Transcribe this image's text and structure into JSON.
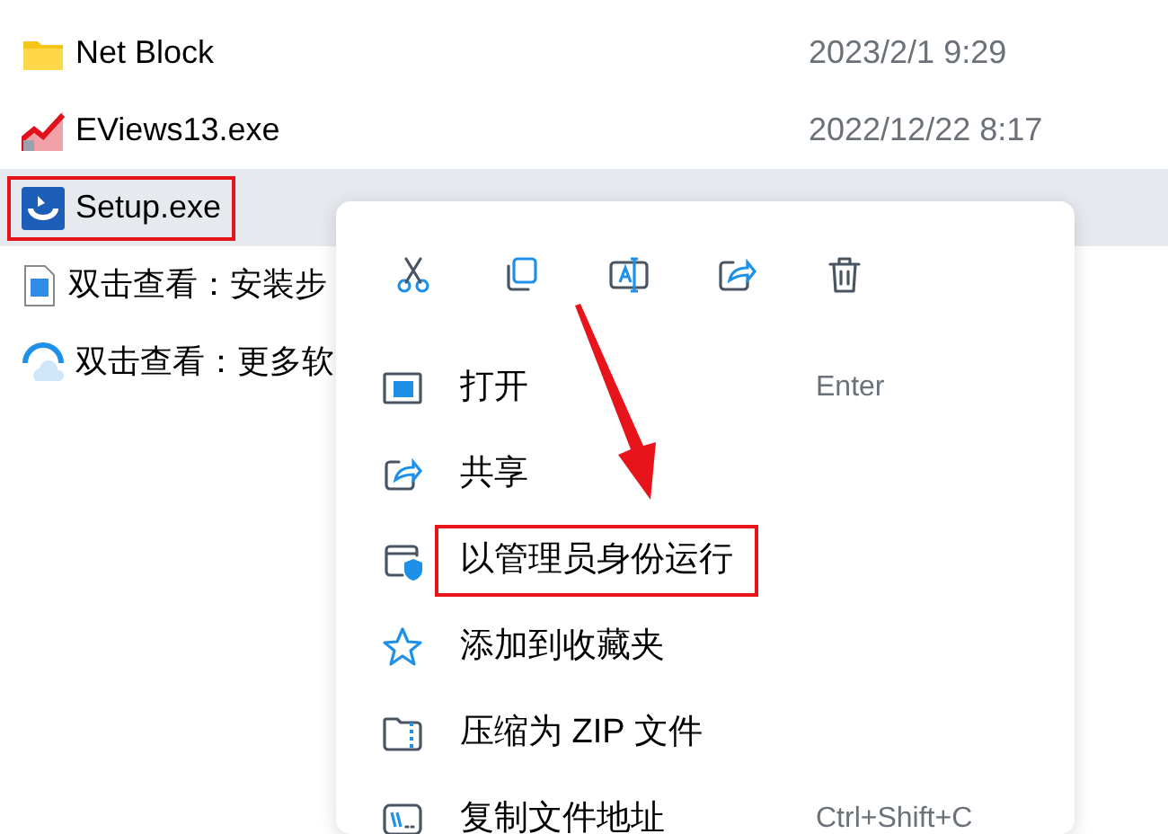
{
  "files": [
    {
      "kind": "folder",
      "name": "Net Block",
      "date": "2023/2/1 9:29",
      "selected": false,
      "highlighted": false
    },
    {
      "kind": "chart",
      "name": "EViews13.exe",
      "date": "2022/12/22 8:17",
      "selected": false,
      "highlighted": false
    },
    {
      "kind": "setup",
      "name": "Setup.exe",
      "selected": true,
      "highlighted": true
    },
    {
      "kind": "image",
      "name": "双击查看：安装步",
      "selected": false,
      "highlighted": false
    },
    {
      "kind": "cloud",
      "name": "双击查看：更多软",
      "selected": false,
      "highlighted": false
    }
  ],
  "context_menu": {
    "toolbar": [
      {
        "kind": "cut"
      },
      {
        "kind": "copy"
      },
      {
        "kind": "rename"
      },
      {
        "kind": "share"
      },
      {
        "kind": "delete"
      }
    ],
    "items": [
      {
        "kind": "open",
        "label": "打开",
        "shortcut": "Enter",
        "highlighted": false
      },
      {
        "kind": "share",
        "label": "共享",
        "highlighted": false
      },
      {
        "kind": "admin",
        "label": "以管理员身份运行",
        "highlighted": true
      },
      {
        "kind": "star",
        "label": "添加到收藏夹",
        "highlighted": false
      },
      {
        "kind": "zip",
        "label": "压缩为 ZIP 文件",
        "highlighted": false
      },
      {
        "kind": "path",
        "label": "复制文件地址",
        "shortcut": "Ctrl+Shift+C",
        "highlighted": false
      }
    ]
  }
}
